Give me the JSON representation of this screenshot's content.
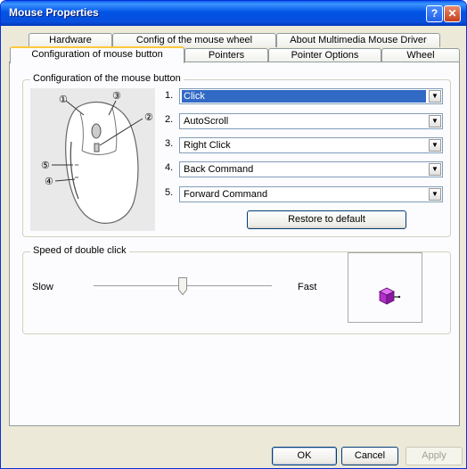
{
  "window": {
    "title": "Mouse Properties",
    "help_label": "?",
    "close_label": "✕"
  },
  "tabs": {
    "row1": [
      "Hardware",
      "Config of the mouse wheel",
      "About Multimedia Mouse Driver"
    ],
    "row2": [
      "Configuration of mouse button",
      "Pointers",
      "Pointer Options",
      "Wheel"
    ],
    "active": "Configuration of mouse button"
  },
  "button_config": {
    "group_label": "Configuration of the mouse button",
    "diagram_labels": [
      "①",
      "②",
      "③",
      "④",
      "⑤"
    ],
    "rows": [
      {
        "number": "1.",
        "value": "Click"
      },
      {
        "number": "2.",
        "value": "AutoScroll"
      },
      {
        "number": "3.",
        "value": "Right Click"
      },
      {
        "number": "4.",
        "value": "Back Command"
      },
      {
        "number": "5.",
        "value": "Forward Command"
      }
    ],
    "restore_label": "Restore to default"
  },
  "double_click": {
    "group_label": "Speed of double click",
    "slow_label": "Slow",
    "fast_label": "Fast",
    "speed_fraction": 0.5
  },
  "footer": {
    "ok_label": "OK",
    "cancel_label": "Cancel",
    "apply_label": "Apply"
  },
  "colors": {
    "title_blue": "#0053e6",
    "selection": "#316ac5",
    "tab_highlight": "#ffc83c",
    "cube": "#c040e0"
  },
  "icons": {
    "combo_arrow": "chevron-down-icon",
    "preview": "test-cube-icon",
    "slider": "slider-thumb-icon"
  }
}
